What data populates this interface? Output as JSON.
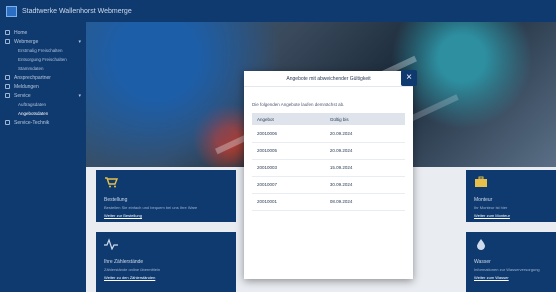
{
  "header": {
    "brand": "Stadtwerke Wallenhorst Webmerge"
  },
  "sidebar": {
    "items": [
      {
        "label": "Home",
        "icon": "home-icon"
      },
      {
        "label": "Webmerge",
        "icon": "grid-icon",
        "expanded": true,
        "children": [
          "Erstmalig Freischalten",
          "Entsorgung Freischalten",
          "Stammdaten"
        ]
      },
      {
        "label": "Ansprechpartner",
        "icon": "user-icon"
      },
      {
        "label": "Meldungen",
        "icon": "bell-icon"
      },
      {
        "label": "Service",
        "icon": "doc-icon",
        "expanded": true,
        "children": [
          "Auftragsdaten",
          "Angebotsdaten"
        ]
      },
      {
        "label": "Service-Technik",
        "icon": "phone-icon"
      }
    ]
  },
  "cards": [
    {
      "title": "Bestellung",
      "text": "Bestellen Sie einfach und bequem bei uns Ihre Ware",
      "link": "Weiter zur Bestellung",
      "icon": "cart-icon"
    },
    {
      "title": "Monteur",
      "text": "Ihr Monteur ist hier",
      "link": "Weiter zum Monteur",
      "icon": "toolbox-icon"
    },
    {
      "title": "Ihre Zählerstände",
      "text": "Zählerstände online übermitteln",
      "link": "Weiter zu den Zählerständen",
      "icon": "pulse-icon"
    },
    {
      "title": "Wasser",
      "text": "Informationen zur Wasserversorgung",
      "link": "Weiter zum Wasser",
      "icon": "drop-icon"
    }
  ],
  "modal": {
    "title": "Angebote mit abweichender Gültigkeit",
    "subtitle": "Die folgenden Angebote laufen demnächst ab.",
    "columns": [
      "Angebot",
      "Gültig bis"
    ],
    "rows": [
      [
        "20010006",
        "20.09.2024"
      ],
      [
        "20010005",
        "20.09.2024"
      ],
      [
        "20010003",
        "15.09.2024"
      ],
      [
        "20010007",
        "30.09.2024"
      ],
      [
        "20010001",
        "08.09.2024"
      ]
    ],
    "close_label": "×"
  }
}
